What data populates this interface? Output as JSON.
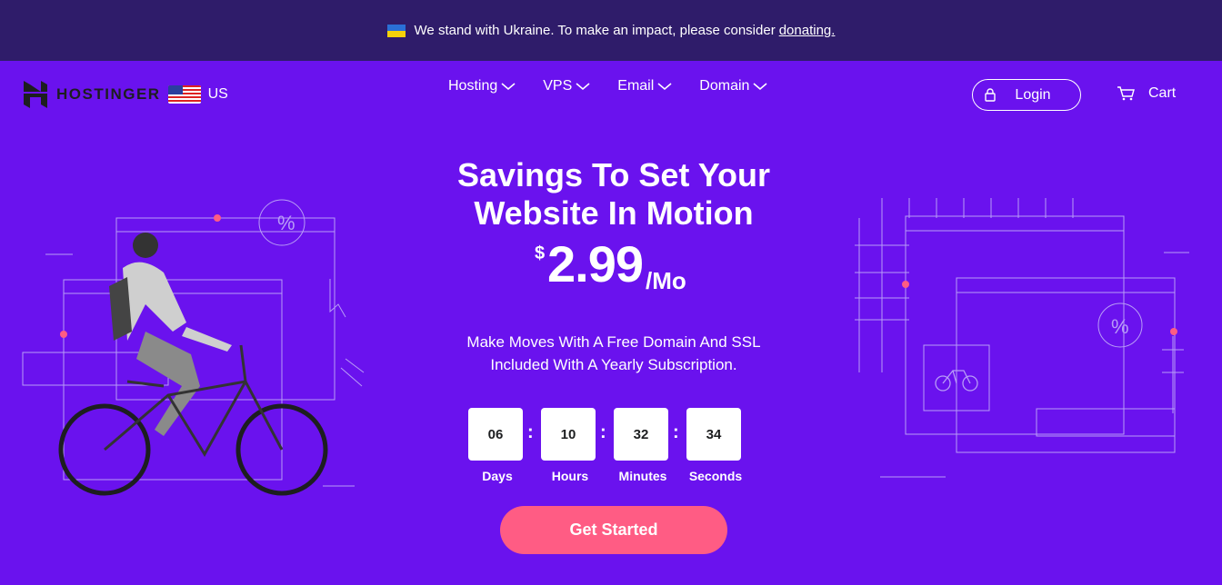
{
  "banner": {
    "text": "We stand with Ukraine. To make an impact, please consider",
    "link": "donating."
  },
  "brand": {
    "name": "HOSTINGER",
    "region": "US"
  },
  "nav": {
    "items": [
      {
        "label": "Hosting"
      },
      {
        "label": "VPS"
      },
      {
        "label": "Email"
      },
      {
        "label": "Domain"
      }
    ],
    "login": "Login",
    "cart": "Cart"
  },
  "hero": {
    "title_line1": "Savings To Set Your",
    "title_line2": "Website In Motion",
    "currency": "$",
    "price": "2.99",
    "period": "/Mo",
    "subtitle_line1": "Make Moves With A Free Domain And SSL",
    "subtitle_line2": "Included With A Yearly Subscription.",
    "cta": "Get Started"
  },
  "countdown": {
    "days": "06",
    "hours": "10",
    "minutes": "32",
    "seconds": "34",
    "labels": {
      "days": "Days",
      "hours": "Hours",
      "minutes": "Minutes",
      "seconds": "Seconds"
    },
    "separator": ":"
  },
  "colors": {
    "background": "#6a12ee",
    "banner": "#2f1c6a",
    "cta": "#ff5c84",
    "accent_dot": "#ff5c84"
  },
  "icons": [
    "ukraine-flag-icon",
    "hostinger-logo-icon",
    "us-flag-icon",
    "chevron-down-icon",
    "lock-icon",
    "cart-icon"
  ]
}
